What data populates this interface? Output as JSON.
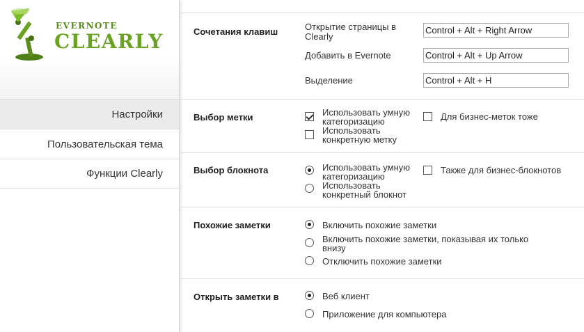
{
  "brand": {
    "small": "EVERNOTE",
    "big": "CLEARLY",
    "color": "#6aa221"
  },
  "sidebar": {
    "items": [
      {
        "label": "Настройки",
        "active": true
      },
      {
        "label": "Пользовательская тема",
        "active": false
      },
      {
        "label": "Функции Clearly",
        "active": false
      }
    ]
  },
  "shortcuts": {
    "label": "Сочетания клавиш",
    "rows": [
      {
        "label": "Открытие страницы в Clearly",
        "value": "Control + Alt + Right Arrow"
      },
      {
        "label": "Добавить в Evernote",
        "value": "Control + Alt + Up Arrow"
      },
      {
        "label": "Выделение",
        "value": "Control + Alt + H"
      }
    ]
  },
  "tag_choice": {
    "label": "Выбор метки",
    "options": [
      {
        "label": "Использовать умную категоризацию",
        "checked": true
      },
      {
        "label": "Использовать конкретную метку",
        "checked": false
      }
    ],
    "extra": {
      "label": "Для бизнес-меток тоже",
      "checked": false
    }
  },
  "notebook_choice": {
    "label": "Выбор блокнота",
    "options": [
      {
        "label": "Использовать умную категоризацию",
        "checked": true
      },
      {
        "label": "Использовать конкретный блокнот",
        "checked": false
      }
    ],
    "extra": {
      "label": "Также для бизнес-блокнотов",
      "checked": false
    }
  },
  "related_notes": {
    "label": "Похожие заметки",
    "options": [
      {
        "label": "Включить похожие заметки",
        "checked": true
      },
      {
        "label": "Включить похожие заметки, показывая их только внизу",
        "checked": false
      },
      {
        "label": "Отключить похожие заметки",
        "checked": false
      }
    ]
  },
  "open_notes": {
    "label": "Открыть заметки в",
    "options": [
      {
        "label": "Веб клиент",
        "checked": true
      },
      {
        "label": "Приложение для компьютера",
        "checked": false
      }
    ]
  }
}
